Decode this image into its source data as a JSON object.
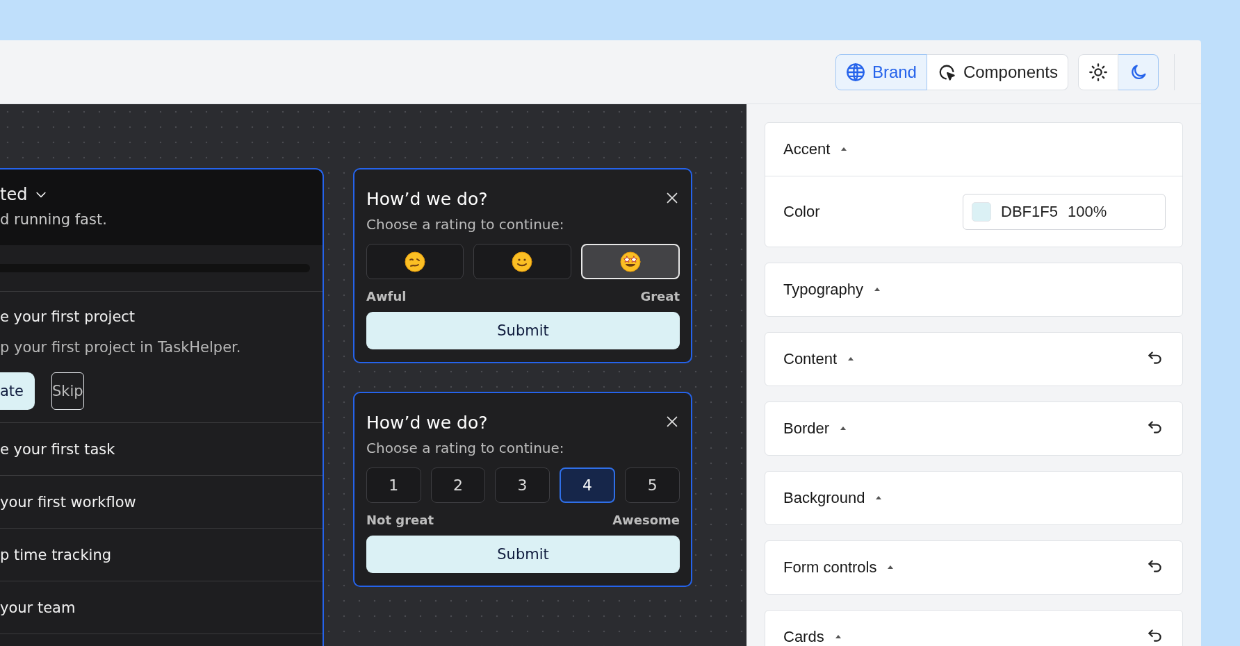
{
  "toolbar": {
    "view_tabs": [
      {
        "label": "Brand",
        "kind": "globe",
        "selected": true
      },
      {
        "label": "Components",
        "kind": "cursor",
        "selected": false
      }
    ],
    "theme_toggle": [
      {
        "kind": "sun",
        "selected": false
      },
      {
        "kind": "moon",
        "selected": true
      }
    ]
  },
  "checklist": {
    "title": "ted",
    "subtitle": "d running fast.",
    "items": [
      {
        "title": "e your first project",
        "expanded": true,
        "description": "p your first project in TaskHelper.",
        "actions": [
          {
            "label": "ate",
            "kind": "primary"
          },
          {
            "label": "Skip",
            "kind": "secondary"
          }
        ]
      },
      {
        "title": "e your first task",
        "expanded": false
      },
      {
        "title": "your first workflow",
        "expanded": false
      },
      {
        "title": "p time tracking",
        "expanded": false
      },
      {
        "title": "your team",
        "expanded": false
      }
    ]
  },
  "feedback_cards": [
    {
      "title": "How’d we do?",
      "prompt": "Choose a rating to continue:",
      "kind": "emoji",
      "options": [
        {
          "kind": "woozy",
          "selected": false
        },
        {
          "kind": "smile",
          "selected": false
        },
        {
          "kind": "star-eyes",
          "selected": true
        }
      ],
      "low_label": "Awful",
      "high_label": "Great",
      "submit": "Submit"
    },
    {
      "title": "How’d we do?",
      "prompt": "Choose a rating to continue:",
      "kind": "number",
      "options": [
        {
          "label": "1",
          "selected": false
        },
        {
          "label": "2",
          "selected": false
        },
        {
          "label": "3",
          "selected": false
        },
        {
          "label": "4",
          "selected": true
        },
        {
          "label": "5",
          "selected": false
        }
      ],
      "low_label": "Not great",
      "high_label": "Awesome",
      "submit": "Submit"
    }
  ],
  "settings": {
    "sections": [
      {
        "title": "Accent",
        "resettable": false,
        "fields": [
          {
            "label": "Color",
            "color": "#dbf1f5",
            "hex": "DBF1F5",
            "opacity": "100%"
          }
        ]
      },
      {
        "title": "Typography",
        "resettable": false
      },
      {
        "title": "Content",
        "resettable": true
      },
      {
        "title": "Border",
        "resettable": true
      },
      {
        "title": "Background",
        "resettable": false
      },
      {
        "title": "Form controls",
        "resettable": true
      },
      {
        "title": "Cards",
        "resettable": true
      }
    ]
  }
}
